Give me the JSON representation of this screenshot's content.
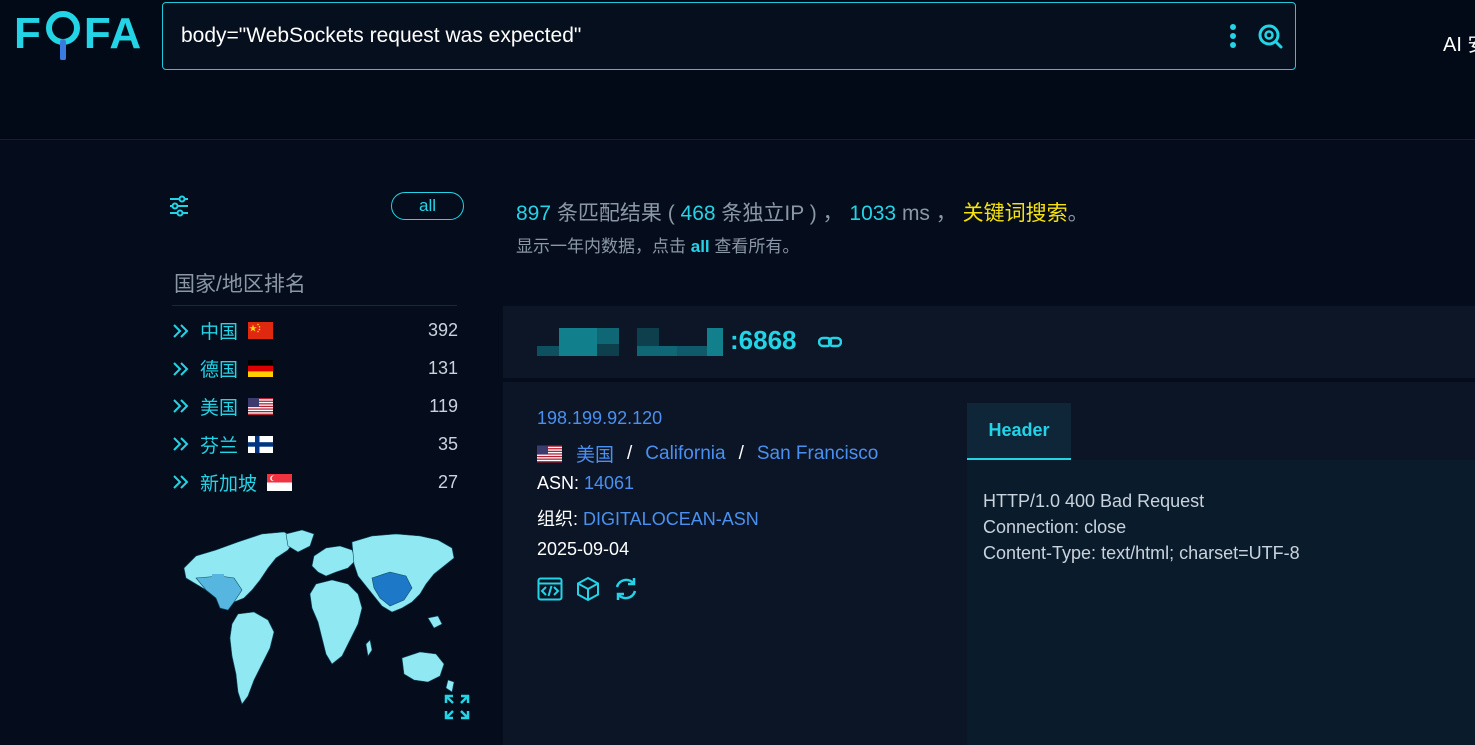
{
  "header": {
    "logo": {
      "left": "F",
      "right": "FA"
    },
    "search": {
      "query": "body=\"WebSockets request was expected\""
    },
    "ai_label": "AI 安"
  },
  "sidebar": {
    "all_label": "all",
    "rank_title": "国家/地区排名",
    "countries": [
      {
        "name": "中国",
        "count": "392",
        "flag": "cn"
      },
      {
        "name": "德国",
        "count": "131",
        "flag": "de"
      },
      {
        "name": "美国",
        "count": "119",
        "flag": "us"
      },
      {
        "name": "芬兰",
        "count": "35",
        "flag": "fi"
      },
      {
        "name": "新加坡",
        "count": "27",
        "flag": "sg"
      }
    ]
  },
  "summary": {
    "matches": "897",
    "matches_text": " 条匹配结果 ( ",
    "unique_ip": "468",
    "unique_ip_text": " 条独立IP ) ， ",
    "time": "1033",
    "time_text": " ms ， ",
    "keyword": "关键词搜索",
    "end": "。",
    "sub_before": "显示一年内数据，点击 ",
    "sub_all": "all",
    "sub_after": " 查看所有。"
  },
  "result": {
    "port": ":6868",
    "ip": "198.199.92.120",
    "country": "美国",
    "region": "California",
    "city": "San Francisco",
    "sep": "/",
    "asn_label": "ASN: ",
    "asn": "14061",
    "org_label": "组织: ",
    "org": "DIGITALOCEAN-ASN",
    "date": "2025-09-04",
    "header_tab": "Header",
    "header_text": "HTTP/1.0 400 Bad Request\nConnection: close\nContent-Type: text/html; charset=UTF-8"
  },
  "colors": {
    "accent": "#22d4e6",
    "link": "#4a90f0",
    "keyword": "#f5e20f",
    "background": "#050d1c"
  },
  "icons": [
    "more-vertical-icon",
    "search-lens-icon",
    "filter-icon",
    "double-chevron-icon",
    "link-icon",
    "code-icon",
    "cube-icon",
    "refresh-icon",
    "expand-icon"
  ]
}
